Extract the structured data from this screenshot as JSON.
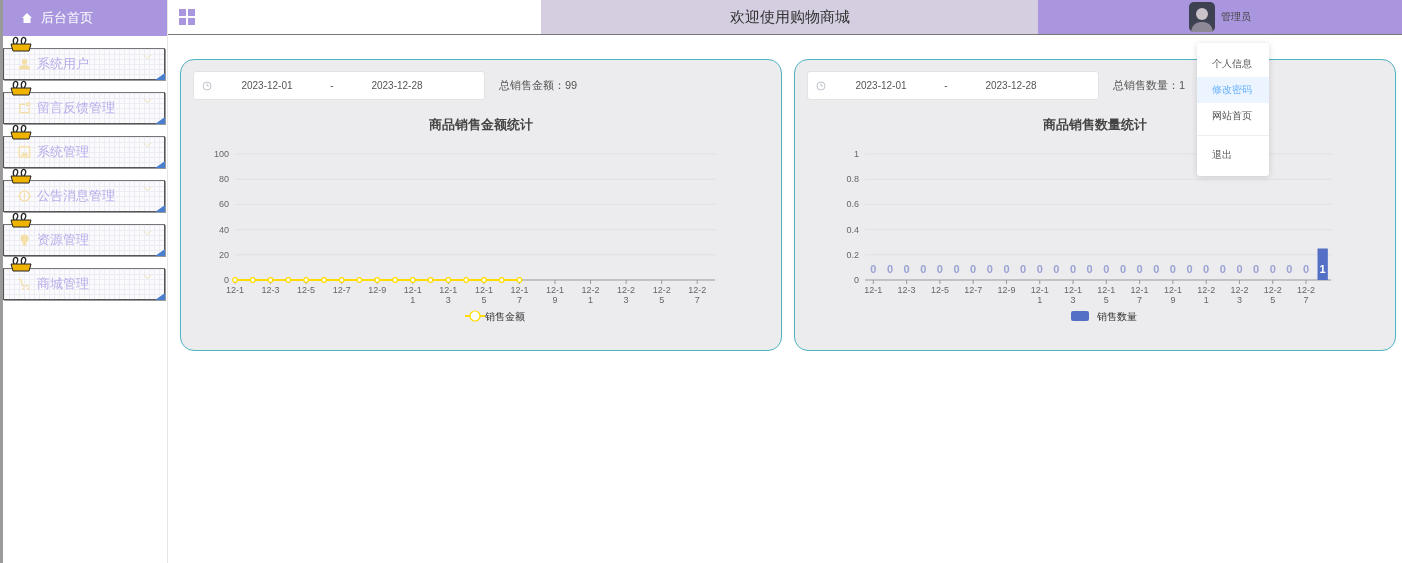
{
  "sidebar": {
    "home": {
      "label": "后台首页"
    },
    "items": [
      {
        "label": "系统用户"
      },
      {
        "label": "留言反馈管理"
      },
      {
        "label": "系统管理"
      },
      {
        "label": "公告消息管理"
      },
      {
        "label": "资源管理"
      },
      {
        "label": "商城管理"
      }
    ]
  },
  "header": {
    "title": "欢迎使用购物商城",
    "user": "管理员"
  },
  "user_menu": [
    {
      "label": "个人信息",
      "selected": false
    },
    {
      "label": "修改密码",
      "selected": true
    },
    {
      "label": "网站首页",
      "selected": false
    },
    {
      "label": "退出",
      "selected": false
    }
  ],
  "cards": [
    {
      "date_start": "2023-12-01",
      "separator": "-",
      "date_end": "2023-12-28",
      "summary": "总销售金额：99",
      "chart_data": {
        "type": "line",
        "title": "商品销售金额统计",
        "grid": true,
        "categories": [
          "12-1",
          null,
          "12-3",
          null,
          "12-5",
          null,
          "12-7",
          null,
          "12-9",
          null,
          "12-11",
          null,
          "12-13",
          null,
          "12-15",
          null,
          "12-17",
          null,
          "12-19",
          null,
          "12-21",
          null,
          "12-23",
          null,
          "12-25",
          null,
          "12-27",
          null
        ],
        "ylim": [
          0,
          100
        ],
        "yticks": [
          0,
          20,
          40,
          60,
          80,
          100
        ],
        "series": [
          {
            "name": "销售金额",
            "color": "#ffdc00",
            "marker": "circle",
            "values": [
              0,
              0,
              0,
              0,
              0,
              0,
              0,
              0,
              0,
              0,
              0,
              0,
              0,
              0,
              0,
              0,
              0,
              null,
              null,
              null,
              null,
              null,
              null,
              null,
              null,
              null,
              null,
              null
            ]
          }
        ]
      }
    },
    {
      "date_start": "2023-12-01",
      "separator": "-",
      "date_end": "2023-12-28",
      "summary": "总销售数量：1",
      "chart_data": {
        "type": "bar",
        "title": "商品销售数量统计",
        "grid": true,
        "categories": [
          "12-1",
          null,
          "12-3",
          null,
          "12-5",
          null,
          "12-7",
          null,
          "12-9",
          null,
          "12-11",
          null,
          "12-13",
          null,
          "12-15",
          null,
          "12-17",
          null,
          "12-19",
          null,
          "12-21",
          null,
          "12-23",
          null,
          "12-25",
          null,
          "12-27",
          null
        ],
        "ylim": [
          0,
          1
        ],
        "yticks": [
          0,
          0.2,
          0.4,
          0.6,
          0.8,
          1
        ],
        "series": [
          {
            "name": "销售数量",
            "color": "#5470c6",
            "values": [
              0,
              0,
              0,
              0,
              0,
              0,
              0,
              0,
              0,
              0,
              0,
              0,
              0,
              0,
              0,
              0,
              0,
              0,
              0,
              0,
              0,
              0,
              0,
              0,
              0,
              0,
              0,
              0.25
            ]
          }
        ],
        "value_labels": [
          "0",
          "0",
          "0",
          "0",
          "0",
          "0",
          "0",
          "0",
          "0",
          "0",
          "0",
          "0",
          "0",
          "0",
          "0",
          "0",
          "0",
          "0",
          "0",
          "0",
          "0",
          "0",
          "0",
          "0",
          "0",
          "0",
          "0",
          "1"
        ]
      }
    }
  ]
}
